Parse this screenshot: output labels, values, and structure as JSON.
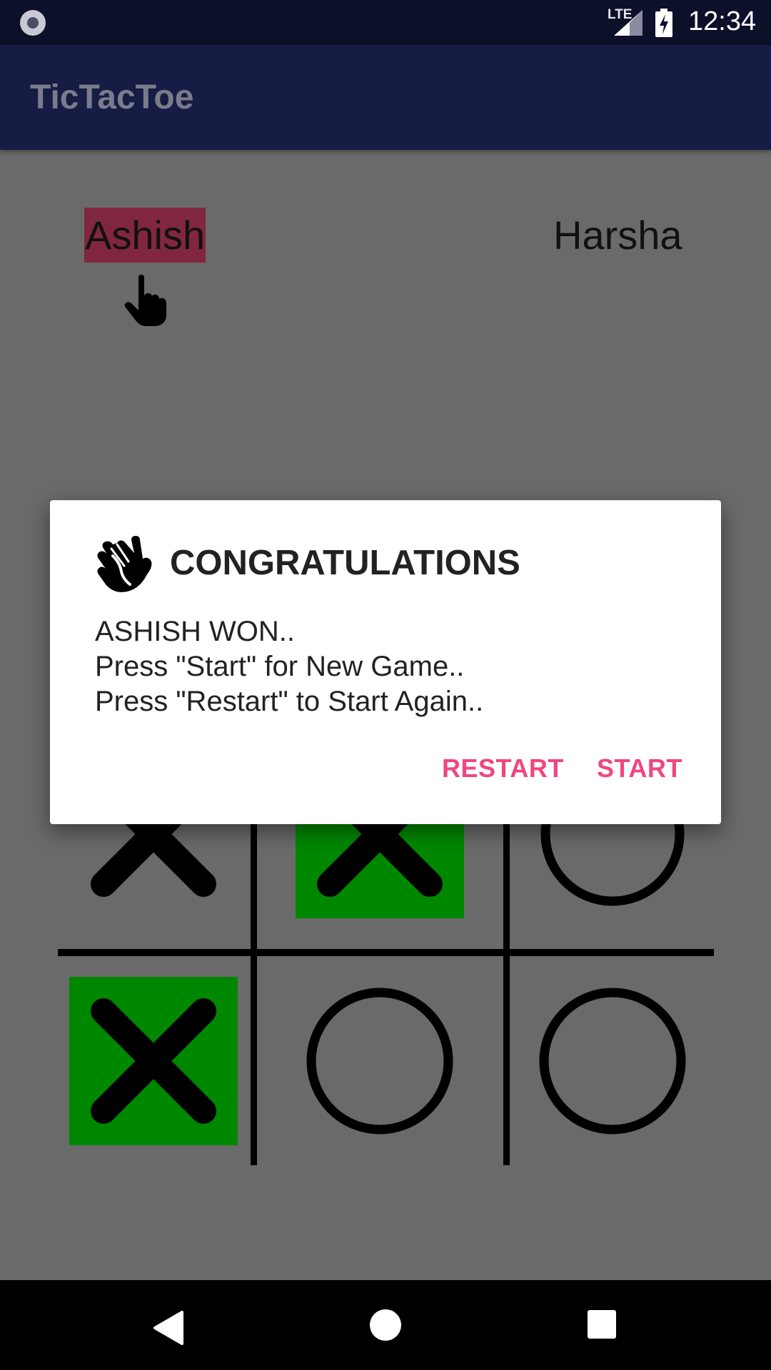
{
  "status_bar": {
    "network": "LTE",
    "time": "12:34"
  },
  "app_bar": {
    "title": "TicTacToe"
  },
  "players": {
    "player1": "Ashish",
    "player2": "Harsha",
    "active_player": "player1"
  },
  "board": {
    "cells": [
      [
        "X",
        "X",
        "O"
      ],
      [
        "X",
        "O",
        "O"
      ]
    ],
    "winning_cells": [
      "row1-col1",
      "row1-col2",
      "row2-col1"
    ]
  },
  "dialog": {
    "title": "CONGRATULATIONS",
    "message_lines": [
      "ASHISH WON..",
      "Press \"Start\" for New Game..",
      "Press \"Restart\" to Start Again.."
    ],
    "restart_label": "RESTART",
    "start_label": "START",
    "accent_color": "#f0467f"
  },
  "colors": {
    "win_highlight": "#008700",
    "active_player_bg": "#80273f",
    "app_bar": "#171c44"
  }
}
